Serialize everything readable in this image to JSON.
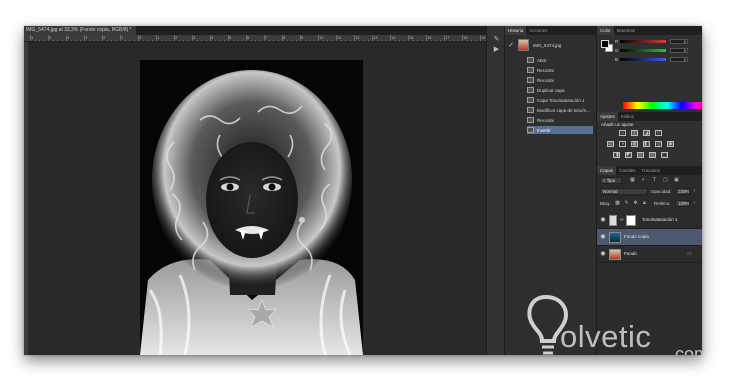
{
  "document": {
    "tab_title": "IMG_5474.jpg al 33,3% (Fondo copia, RGB/8)",
    "tab_modified": "*",
    "tab_close": "×",
    "ruler_numbers": [
      "4",
      "5",
      "4",
      "3",
      "2",
      "1",
      "0",
      "1",
      "2",
      "3",
      "4",
      "5",
      "6",
      "7",
      "8",
      "9",
      "10",
      "11",
      "12",
      "13",
      "14",
      "15",
      "16",
      "17",
      "18",
      "19"
    ]
  },
  "history_panel": {
    "tabs": [
      "Historia",
      "Acciones"
    ],
    "snapshot_label": "IMG_5474.jpg",
    "states": [
      {
        "label": "Abrir",
        "active": false
      },
      {
        "label": "Recortar",
        "active": false
      },
      {
        "label": "Recortar",
        "active": false
      },
      {
        "label": "Duplicar capa",
        "active": false
      },
      {
        "label": "Capa Tono/saturación 1",
        "active": false
      },
      {
        "label": "Modificar capa de tono/s...",
        "active": false
      },
      {
        "label": "Recortar",
        "active": false
      },
      {
        "label": "Invertir",
        "active": true
      }
    ]
  },
  "color_panel": {
    "tabs": [
      "Color",
      "Muestras"
    ],
    "channels": [
      {
        "label": "R",
        "value": "0",
        "bar_color": "#e23a3a"
      },
      {
        "label": "G",
        "value": "0",
        "bar_color": "#3ab84a"
      },
      {
        "label": "B",
        "value": "0",
        "bar_color": "#3a5ee2"
      }
    ]
  },
  "adjustments_panel": {
    "tabs": [
      "Ajustes",
      "Estilos"
    ],
    "title": "Añadir un ajuste"
  },
  "layers_panel": {
    "tabs": [
      "Capas",
      "Canales",
      "Trazados"
    ],
    "filter_kind": "Tipo",
    "blend_mode": "Normal",
    "opacity_label": "Opacidad:",
    "opacity_value": "100%",
    "lock_label": "Bloq.:",
    "fill_label": "Relleno:",
    "fill_value": "100%",
    "layers": [
      {
        "name": "Tono/saturación 1",
        "selected": false
      },
      {
        "name": "Fondo copia",
        "selected": true
      },
      {
        "name": "Fondo",
        "selected": false
      }
    ]
  },
  "watermark": {
    "brand": "olvetic",
    "domain": ".com"
  },
  "colors": {
    "selection": "#4e5870",
    "history_active": "#5a6f94"
  }
}
